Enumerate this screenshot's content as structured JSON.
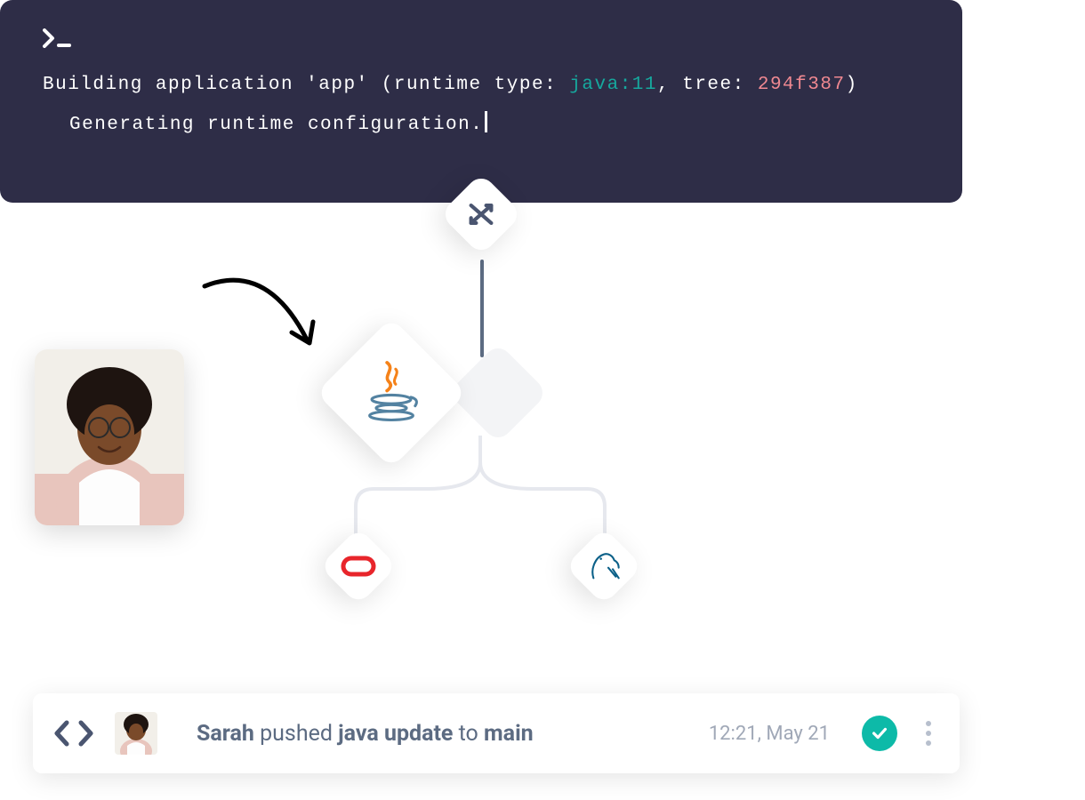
{
  "terminal": {
    "line1_pre": "Building application 'app' (runtime type: ",
    "runtime": "java:11",
    "line1_mid": ", tree: ",
    "tree": "294f387",
    "line1_post": ")",
    "line2": "Generating runtime configuration."
  },
  "diagram": {
    "nodes": {
      "top": "shuffle-icon",
      "center": "java-icon",
      "left": "oracle-icon",
      "right": "mysql-icon"
    }
  },
  "activity": {
    "user": "Sarah",
    "action_pre": " pushed ",
    "commit": "java update",
    "action_mid": " to ",
    "branch": "main",
    "timestamp": "12:21, May 21",
    "status": "success"
  },
  "colors": {
    "terminal_bg": "#2e2d47",
    "teal": "#16a89e",
    "salmon": "#ef8891",
    "status_green": "#0dbaa8",
    "oracle_red": "#e8252b",
    "mysql_blue": "#0b6088"
  }
}
